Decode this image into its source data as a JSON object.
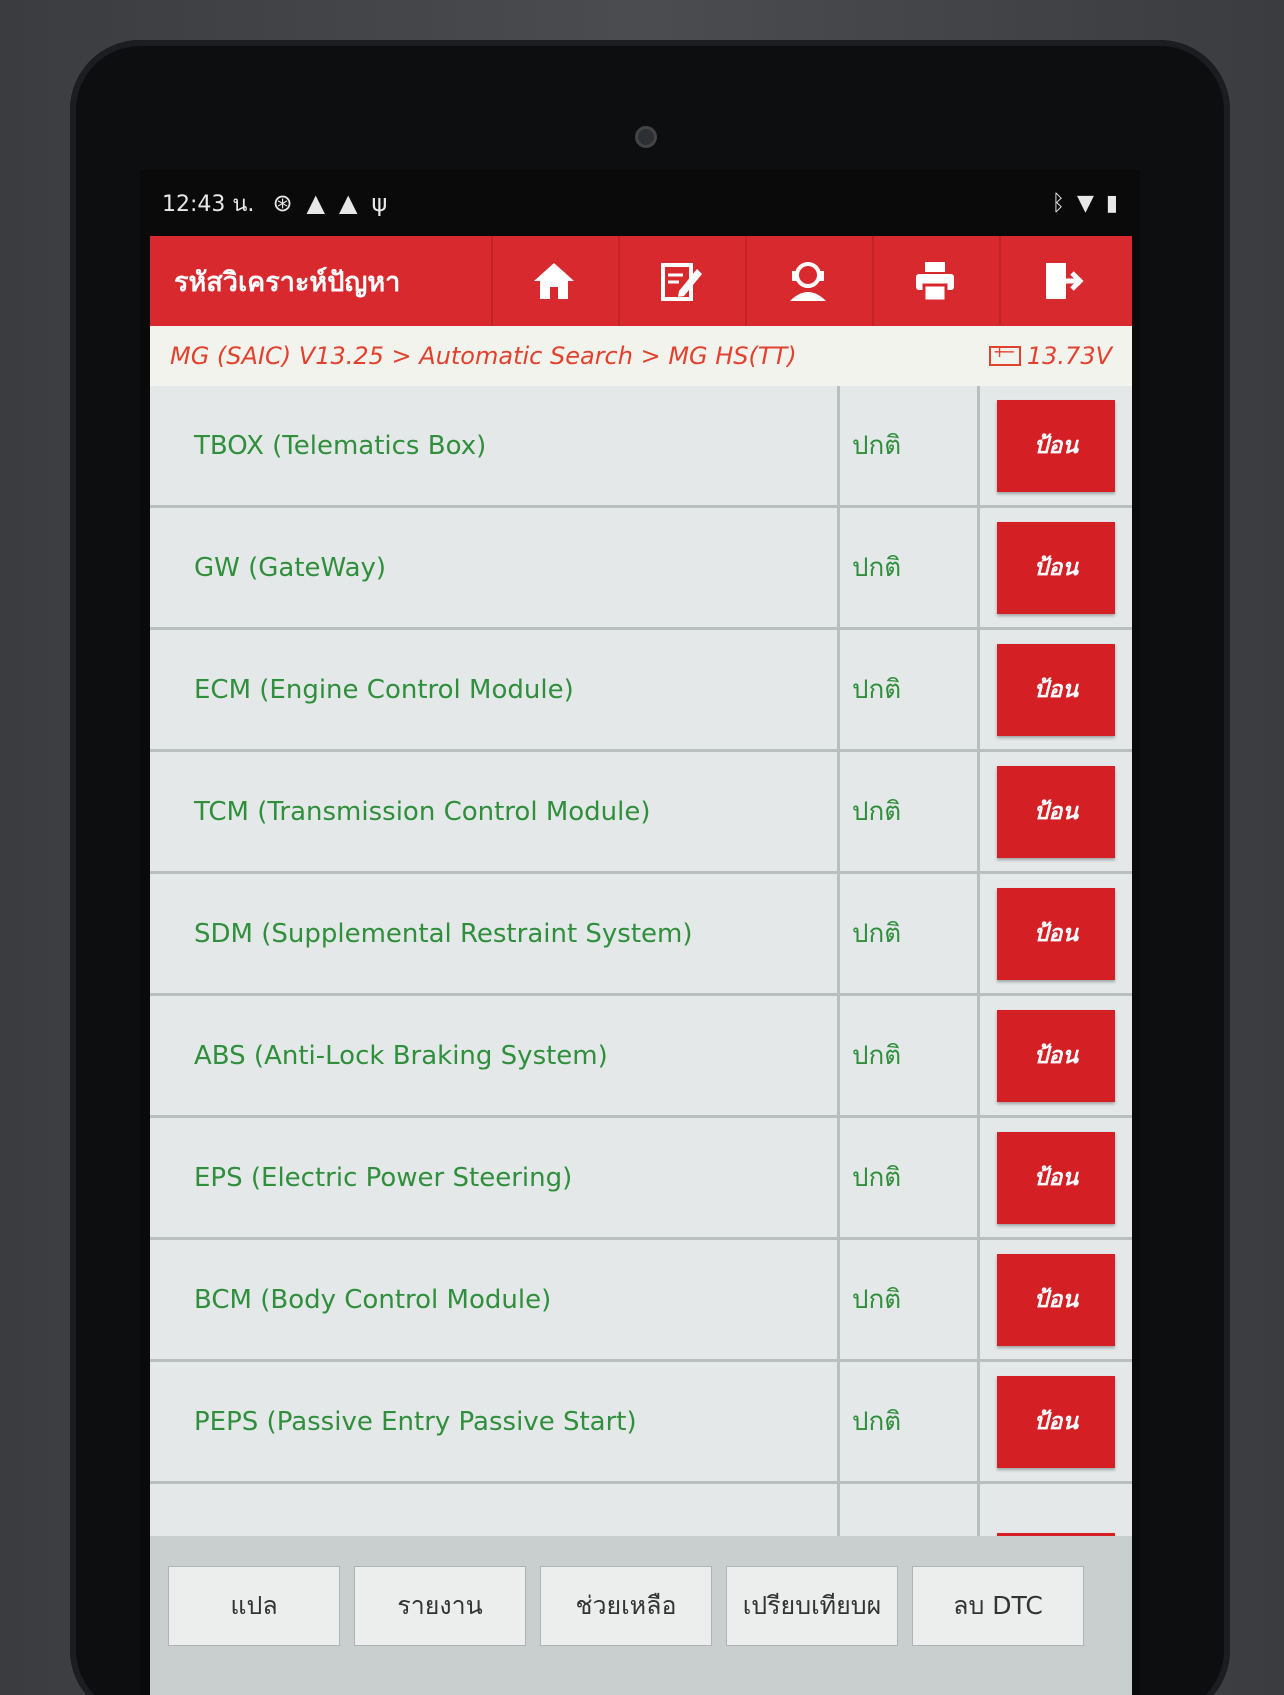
{
  "status_bar": {
    "time": "12:43 น.",
    "left_icons": [
      "settings-icon",
      "warning-icon",
      "warning-icon",
      "usb-icon"
    ],
    "right_icons": [
      "bluetooth-icon",
      "wifi-icon",
      "battery-icon"
    ]
  },
  "app_bar": {
    "title": "รหัสวิเคราะห์ปัญหา",
    "tools": [
      "home-icon",
      "edit-icon",
      "user-support-icon",
      "print-icon",
      "exit-icon"
    ]
  },
  "breadcrumb": {
    "path": "MG (SAIC) V13.25 > Automatic Search > MG HS(TT)",
    "voltage": "13.73V"
  },
  "systems": [
    {
      "name": "TBOX (Telematics Box)",
      "status": "ปกติ",
      "action": "ป้อน"
    },
    {
      "name": "GW (GateWay)",
      "status": "ปกติ",
      "action": "ป้อน"
    },
    {
      "name": "ECM (Engine Control Module)",
      "status": "ปกติ",
      "action": "ป้อน"
    },
    {
      "name": "TCM (Transmission Control Module)",
      "status": "ปกติ",
      "action": "ป้อน"
    },
    {
      "name": "SDM (Supplemental Restraint System)",
      "status": "ปกติ",
      "action": "ป้อน"
    },
    {
      "name": "ABS (Anti-Lock Braking System)",
      "status": "ปกติ",
      "action": "ป้อน"
    },
    {
      "name": "EPS (Electric Power Steering)",
      "status": "ปกติ",
      "action": "ป้อน"
    },
    {
      "name": "BCM (Body Control Module)",
      "status": "ปกติ",
      "action": "ป้อน"
    },
    {
      "name": "PEPS (Passive Entry Passive Start)",
      "status": "ปกติ",
      "action": "ป้อน"
    }
  ],
  "bottom_buttons": [
    "แปล",
    "รายงาน",
    "ช่วยเหลือ",
    "เปรียบเทียบผ",
    "ลบ DTC"
  ],
  "colors": {
    "accent_red": "#d82a2e",
    "text_green": "#2f8f3c",
    "breadcrumb_orange": "#e2412d"
  }
}
